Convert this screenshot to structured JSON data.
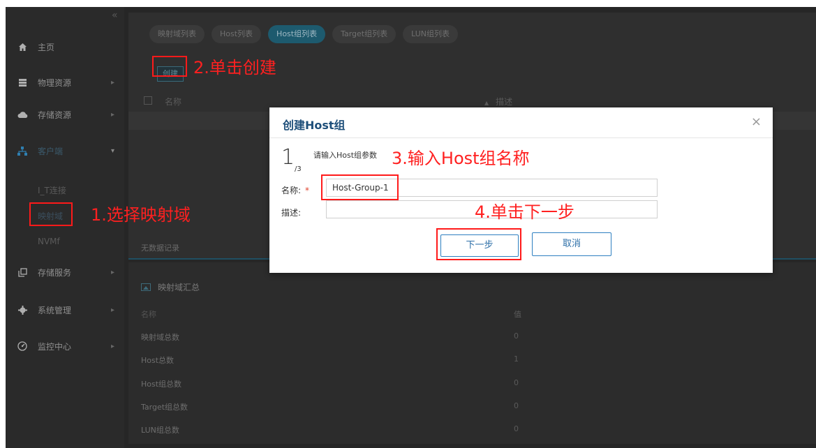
{
  "sidebar": {
    "collapse": "«",
    "items": [
      {
        "label": "主页",
        "icon": "home-icon"
      },
      {
        "label": "物理资源",
        "icon": "server-icon"
      },
      {
        "label": "存储资源",
        "icon": "cloud-icon"
      },
      {
        "label": "客户端",
        "icon": "network-icon"
      },
      {
        "label": "存储服务",
        "icon": "copy-icon"
      },
      {
        "label": "系统管理",
        "icon": "gear-icon"
      },
      {
        "label": "监控中心",
        "icon": "gauge-icon"
      }
    ],
    "sub_items": [
      "I_T连接",
      "映射域",
      "NVMf"
    ]
  },
  "tabs": [
    "映射域列表",
    "Host列表",
    "Host组列表",
    "Target组列表",
    "LUN组列表"
  ],
  "active_tab": "Host组列表",
  "toolbar": {
    "create_label": "创建"
  },
  "table": {
    "col_name": "名称",
    "col_desc": "描述",
    "sort_icon": "▲",
    "empty_text": "无数据记录"
  },
  "summary": {
    "title": "映射域汇总",
    "header": {
      "k": "名称",
      "v": "值"
    },
    "rows": [
      {
        "k": "映射域总数",
        "v": "0"
      },
      {
        "k": "Host总数",
        "v": "1"
      },
      {
        "k": "Host组总数",
        "v": "0"
      },
      {
        "k": "Target组总数",
        "v": "0"
      },
      {
        "k": "LUN组总数",
        "v": "0"
      }
    ]
  },
  "dialog": {
    "title": "创建Host组",
    "close": "×",
    "step_current": "1",
    "step_total": "/3",
    "step_desc": "请输入Host组参数",
    "name_label": "名称:",
    "required_mark": "*",
    "name_value": "Host-Group-1",
    "desc_label": "描述:",
    "desc_value": "",
    "next_label": "下一步",
    "cancel_label": "取消"
  },
  "annotations": {
    "a1": "1.选择映射域",
    "a2": "2.单击创建",
    "a3": "3.输入Host组名称",
    "a4": "4.单击下一步"
  },
  "colors": {
    "annotation": "#ff1a1a",
    "dialog_title": "#1e4f7a",
    "button_border": "#2d7fc0"
  }
}
